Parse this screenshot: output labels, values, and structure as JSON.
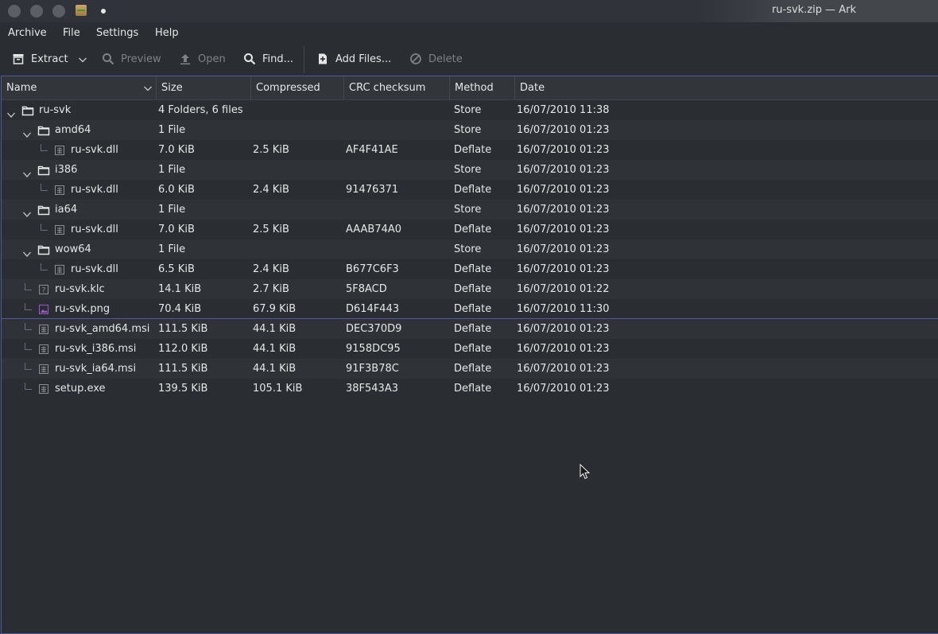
{
  "window": {
    "title": "ru-svk.zip — Ark"
  },
  "menu": [
    "Archive",
    "File",
    "Settings",
    "Help"
  ],
  "toolbar": {
    "extract": "Extract",
    "preview": "Preview",
    "open": "Open",
    "find": "Find...",
    "add_files": "Add Files...",
    "delete": "Delete"
  },
  "columns": [
    "Name",
    "Size",
    "Compressed",
    "CRC checksum",
    "Method",
    "Date"
  ],
  "rows": [
    {
      "name": "ru-svk",
      "size": "4 Folders, 6 files",
      "compressed": "",
      "crc": "",
      "method": "Store",
      "date": "16/07/2010 11:38",
      "type": "folder",
      "level": 0
    },
    {
      "name": "amd64",
      "size": "1 File",
      "compressed": "",
      "crc": "",
      "method": "Store",
      "date": "16/07/2010 01:23",
      "type": "folder",
      "level": 1
    },
    {
      "name": "ru-svk.dll",
      "size": "7.0 KiB",
      "compressed": "2.5 KiB",
      "crc": "AF4F41AE",
      "method": "Deflate",
      "date": "16/07/2010 01:23",
      "type": "binary",
      "level": 2
    },
    {
      "name": "i386",
      "size": "1 File",
      "compressed": "",
      "crc": "",
      "method": "Store",
      "date": "16/07/2010 01:23",
      "type": "folder",
      "level": 1
    },
    {
      "name": "ru-svk.dll",
      "size": "6.0 KiB",
      "compressed": "2.4 KiB",
      "crc": "91476371",
      "method": "Deflate",
      "date": "16/07/2010 01:23",
      "type": "binary",
      "level": 2
    },
    {
      "name": "ia64",
      "size": "1 File",
      "compressed": "",
      "crc": "",
      "method": "Store",
      "date": "16/07/2010 01:23",
      "type": "folder",
      "level": 1
    },
    {
      "name": "ru-svk.dll",
      "size": "7.0 KiB",
      "compressed": "2.5 KiB",
      "crc": "AAAB74A0",
      "method": "Deflate",
      "date": "16/07/2010 01:23",
      "type": "binary",
      "level": 2
    },
    {
      "name": "wow64",
      "size": "1 File",
      "compressed": "",
      "crc": "",
      "method": "Store",
      "date": "16/07/2010 01:23",
      "type": "folder",
      "level": 1
    },
    {
      "name": "ru-svk.dll",
      "size": "6.5 KiB",
      "compressed": "2.4 KiB",
      "crc": "B677C6F3",
      "method": "Deflate",
      "date": "16/07/2010 01:23",
      "type": "binary",
      "level": 2
    },
    {
      "name": "ru-svk.klc",
      "size": "14.1 KiB",
      "compressed": "2.7 KiB",
      "crc": "5F8ACD",
      "method": "Deflate",
      "date": "16/07/2010 01:22",
      "type": "unknown",
      "level": 1
    },
    {
      "name": "ru-svk.png",
      "size": "70.4 KiB",
      "compressed": "67.9 KiB",
      "crc": "D614F443",
      "method": "Deflate",
      "date": "16/07/2010 11:30",
      "type": "image",
      "level": 1
    },
    {
      "name": "ru-svk_amd64.msi",
      "size": "111.5 KiB",
      "compressed": "44.1 KiB",
      "crc": "DEC370D9",
      "method": "Deflate",
      "date": "16/07/2010 01:23",
      "type": "binary",
      "level": 1
    },
    {
      "name": "ru-svk_i386.msi",
      "size": "112.0 KiB",
      "compressed": "44.1 KiB",
      "crc": "9158DC95",
      "method": "Deflate",
      "date": "16/07/2010 01:23",
      "type": "binary",
      "level": 1
    },
    {
      "name": "ru-svk_ia64.msi",
      "size": "111.5 KiB",
      "compressed": "44.1 KiB",
      "crc": "91F3B78C",
      "method": "Deflate",
      "date": "16/07/2010 01:23",
      "type": "binary",
      "level": 1
    },
    {
      "name": "setup.exe",
      "size": "139.5 KiB",
      "compressed": "105.1 KiB",
      "crc": "38F543A3",
      "method": "Deflate",
      "date": "16/07/2010 01:23",
      "type": "binary",
      "level": 1
    }
  ],
  "colors": {
    "background": "#2a2e32",
    "alt_row": "#2f3338",
    "accent": "#4f5a9a",
    "image_icon": "#9b59d0"
  }
}
